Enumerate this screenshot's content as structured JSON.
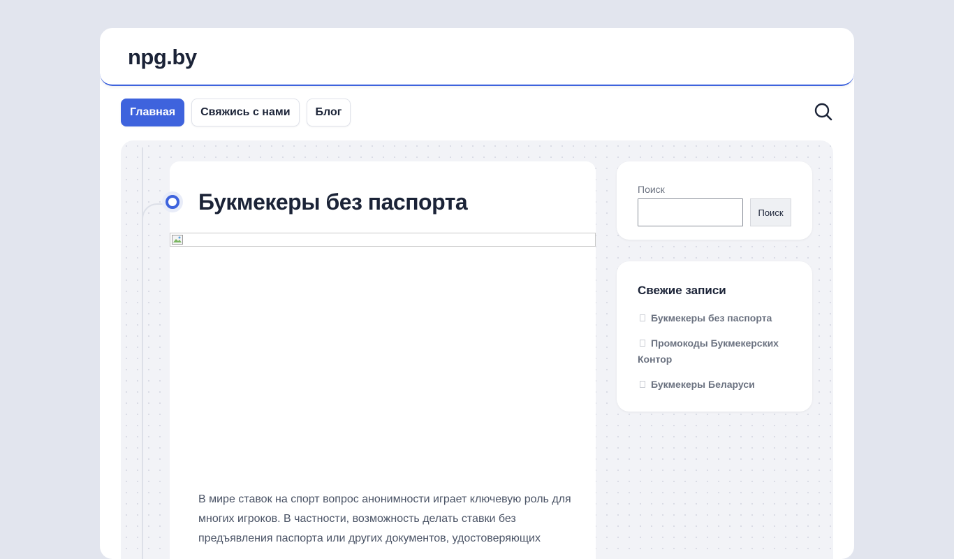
{
  "site": {
    "title": "npg.by"
  },
  "nav": {
    "items": [
      {
        "label": "Главная",
        "active": true
      },
      {
        "label": "Свяжись с нами",
        "active": false
      },
      {
        "label": "Блог",
        "active": false
      }
    ]
  },
  "icons": {
    "search_toggle": "search-icon",
    "timeline": "timeline-dot-icon",
    "broken_image": "broken-image-icon",
    "bullet": "bullet-icon"
  },
  "colors": {
    "accent": "#3e63dd",
    "text": "#1b2337",
    "muted": "#6b7280",
    "background": "#e2e5ee",
    "content_bg": "#f2f3f7"
  },
  "article": {
    "title": "Букмекеры без паспорта",
    "body": "В мире ставок на спорт вопрос анонимности играет ключевую роль для многих игроков. В частности, возможность делать ставки без предъявления паспорта или других документов, удостоверяющих"
  },
  "sidebar": {
    "search": {
      "label": "Поиск",
      "input_value": "",
      "button_label": "Поиск"
    },
    "recent": {
      "title": "Свежие записи",
      "items": [
        "Букмекеры без паспорта",
        "Промокоды Букмекерских Контор",
        "Букмекеры Беларуси"
      ]
    }
  }
}
